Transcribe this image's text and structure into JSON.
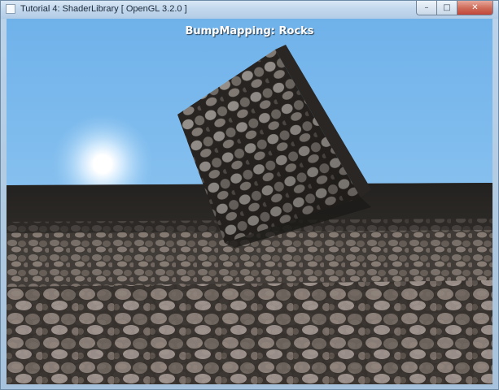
{
  "window": {
    "title": "Tutorial 4: ShaderLibrary [ OpenGL 3.2.0 ]",
    "buttons": {
      "minimize": "–",
      "maximize": "□",
      "close": "✕"
    }
  },
  "scene": {
    "overlay_title": "BumpMapping: Rocks",
    "sky_color": "#7ab6e8",
    "sun_color": "#ffffff",
    "ground_color": "#4a4540",
    "cube_color": "#3a3530"
  }
}
